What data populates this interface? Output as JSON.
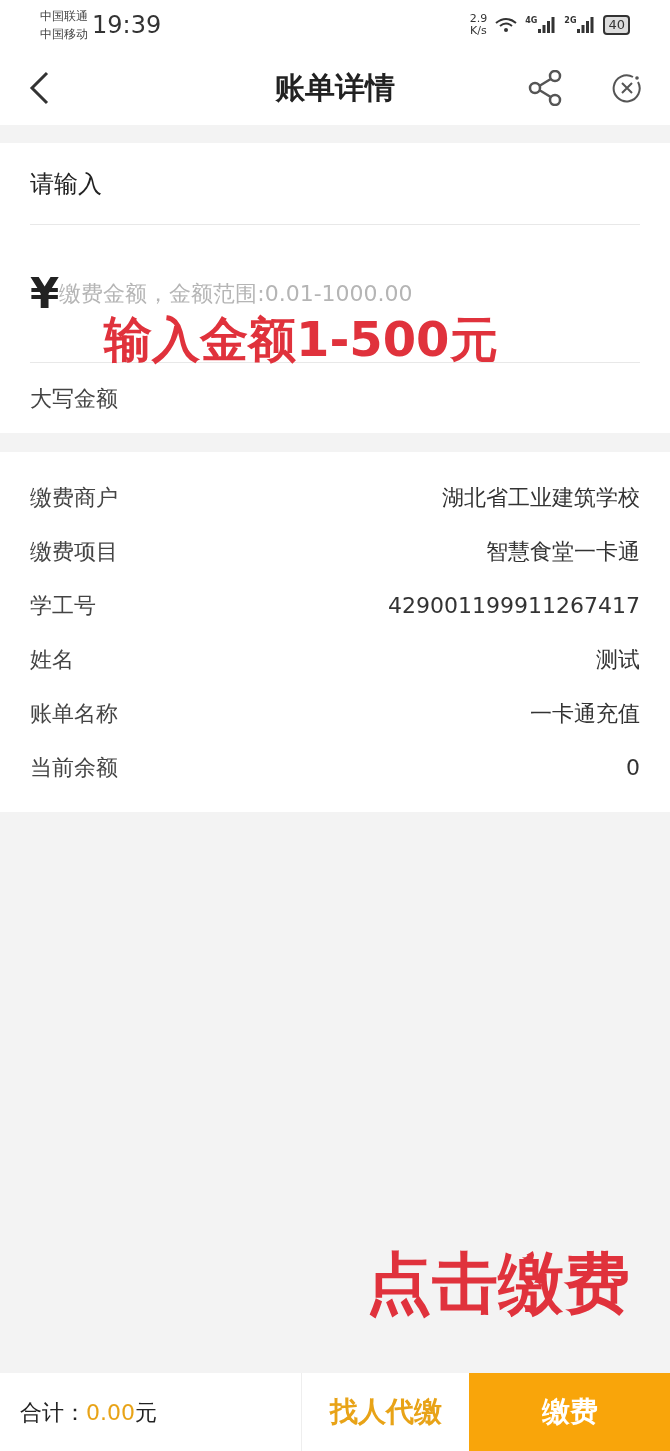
{
  "status_bar": {
    "carriers": [
      "中国联通",
      "中国移动"
    ],
    "time": "19:39",
    "speed": [
      "2.9",
      "K/s"
    ],
    "net1": "4G",
    "net2": "2G",
    "battery": "40"
  },
  "nav": {
    "title": "账单详情"
  },
  "form": {
    "prompt": "请输入",
    "currency": "¥",
    "amount_placeholder": "缴费金额，金额范围:0.01-1000.00",
    "uppercase_label": "大写金额"
  },
  "details": [
    {
      "label": "缴费商户",
      "value": "湖北省工业建筑学校"
    },
    {
      "label": "缴费项目",
      "value": "智慧食堂一卡通"
    },
    {
      "label": "学工号",
      "value": "429001199911267417"
    },
    {
      "label": "姓名",
      "value": "测试"
    },
    {
      "label": "账单名称",
      "value": "一卡通充值"
    },
    {
      "label": "当前余额",
      "value": "0"
    }
  ],
  "annotations": [
    "输入金额1-500元",
    "点击缴费"
  ],
  "footer": {
    "total_label": "合计：",
    "total_value": "0.00",
    "unit": "元",
    "proxy_button": "找人代缴",
    "pay_button": "缴费"
  }
}
